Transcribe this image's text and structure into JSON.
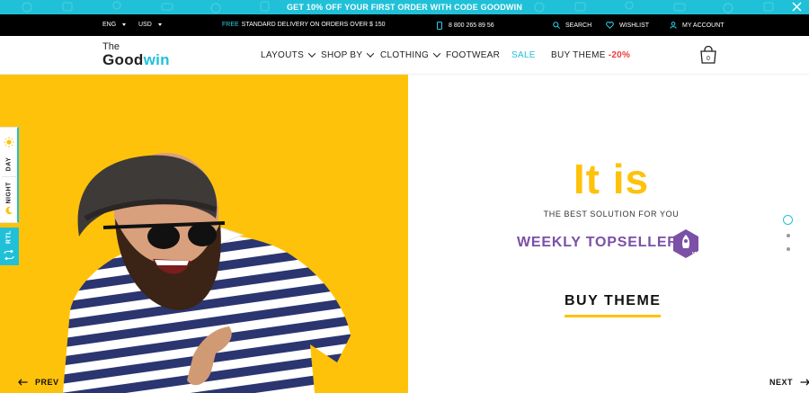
{
  "promo": {
    "text": "GET 10% OFF YOUR FIRST ORDER WITH CODE GOODWIN"
  },
  "topbar": {
    "language": "ENG",
    "currency": "USD",
    "delivery_free": "FREE",
    "delivery_rest": "STANDARD DELIVERY ON ORDERS OVER $ 150",
    "phone": "8 800 265 89 56",
    "search": "SEARCH",
    "wishlist": "WISHLIST",
    "account": "MY ACCOUNT"
  },
  "logo": {
    "line1": "The",
    "line2_a": "Good",
    "line2_b": "win"
  },
  "nav": {
    "layouts": "LAYOUTS",
    "shop_by": "SHOP BY",
    "clothing": "CLOTHING",
    "footwear": "FOOTWEAR",
    "sale": "SALE",
    "buy_theme": "BUY THEME",
    "buy_theme_badge": "-20%"
  },
  "cart": {
    "count": "0"
  },
  "hero": {
    "headline": "It is",
    "subtitle": "THE BEST SOLUTION FOR YOU",
    "topseller": "WEEKLY TOPSELLER",
    "cta": "BUY THEME",
    "prev": "PREV",
    "next": "NEXT"
  },
  "side": {
    "day": "DAY",
    "night": "NIGHT",
    "rtl": "RTL"
  },
  "colors": {
    "accent": "#20c1d8",
    "yellow": "#ffc20b",
    "purple": "#7b50a6",
    "sale_red": "#f03a3a"
  }
}
